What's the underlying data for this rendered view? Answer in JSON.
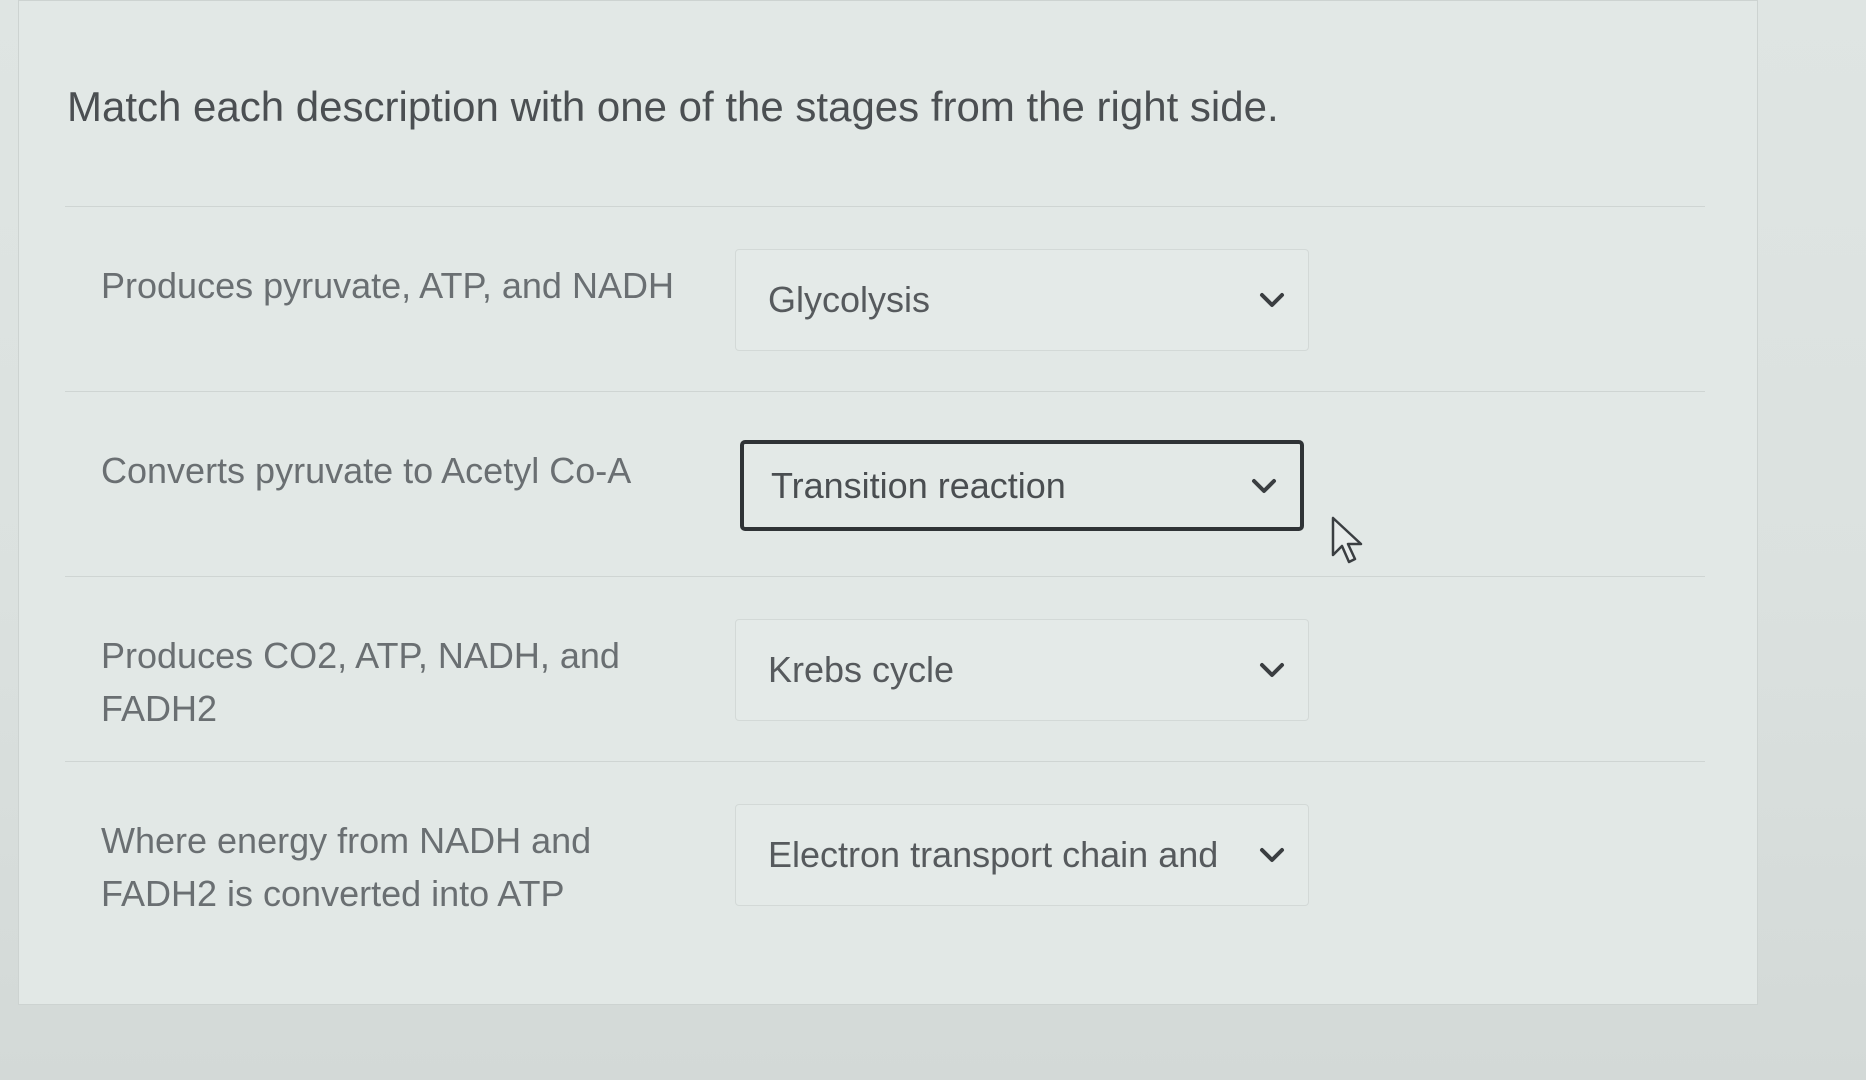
{
  "question": {
    "text": "Match each description with one of the stages from the right side."
  },
  "rows": [
    {
      "description": "Produces pyruvate, ATP, and NADH",
      "selected": "Glycolysis"
    },
    {
      "description": "Converts pyruvate to Acetyl Co-A",
      "selected": "Transition reaction"
    },
    {
      "description": "Produces CO2, ATP, NADH, and FADH2",
      "selected": "Krebs cycle"
    },
    {
      "description": "Where energy from NADH and FADH2 is converted into ATP",
      "selected": "Electron transport chain and"
    }
  ],
  "icons": {
    "dropdown": "chevron-down-icon",
    "pointer": "mouse-cursor-icon"
  },
  "colors": {
    "focus_border": "#2f3336",
    "text_primary": "#4b4f52",
    "text_muted": "#6a6f72"
  }
}
